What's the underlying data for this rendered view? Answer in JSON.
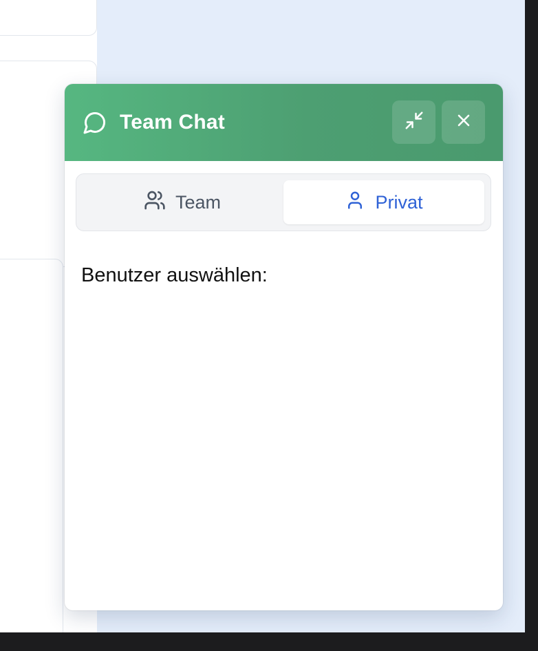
{
  "chat": {
    "title": "Team Chat",
    "minimize_icon": "minimize-icon",
    "close_icon": "close-icon",
    "header_icon": "chat-bubble-icon"
  },
  "tabs": [
    {
      "label": "Team",
      "icon": "users-icon",
      "active": false
    },
    {
      "label": "Privat",
      "icon": "user-icon",
      "active": true
    }
  ],
  "content": {
    "select_user_label": "Benutzer auswählen:"
  },
  "colors": {
    "header_start": "#56b781",
    "header_end": "#4a9a6e",
    "active_tab_text": "#2f62d6",
    "inactive_tab_text": "#4b5563",
    "page_background": "#e4edfa"
  }
}
